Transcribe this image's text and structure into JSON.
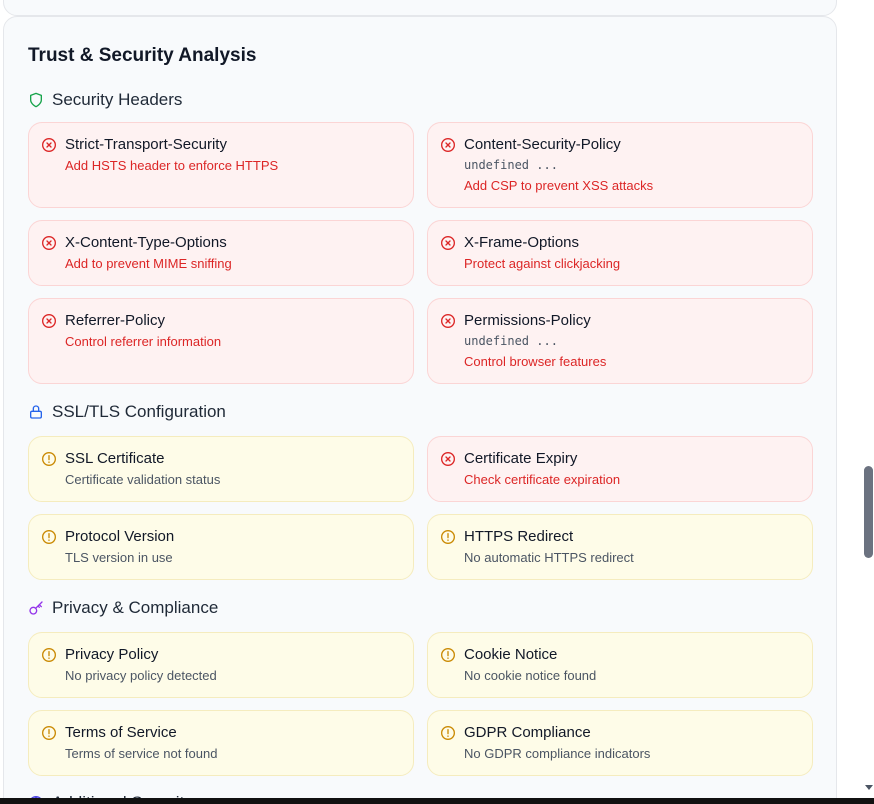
{
  "card_title": "Trust & Security Analysis",
  "sections": {
    "security_headers": {
      "title": "Security Headers",
      "icon": "shield-icon",
      "items": [
        {
          "name": "Strict-Transport-Security",
          "status": "error",
          "desc": "Add HSTS header to enforce HTTPS"
        },
        {
          "name": "Content-Security-Policy",
          "status": "error",
          "value": "undefined ...",
          "desc": "Add CSP to prevent XSS attacks"
        },
        {
          "name": "X-Content-Type-Options",
          "status": "error",
          "desc": "Add to prevent MIME sniffing"
        },
        {
          "name": "X-Frame-Options",
          "status": "error",
          "desc": "Protect against clickjacking"
        },
        {
          "name": "Referrer-Policy",
          "status": "error",
          "desc": "Control referrer information"
        },
        {
          "name": "Permissions-Policy",
          "status": "error",
          "value": "undefined ...",
          "desc": "Control browser features"
        }
      ]
    },
    "ssl_tls": {
      "title": "SSL/TLS Configuration",
      "icon": "lock-icon",
      "items": [
        {
          "name": "SSL Certificate",
          "status": "warning",
          "desc": "Certificate validation status"
        },
        {
          "name": "Certificate Expiry",
          "status": "error",
          "desc": "Check certificate expiration"
        },
        {
          "name": "Protocol Version",
          "status": "warning",
          "desc": "TLS version in use"
        },
        {
          "name": "HTTPS Redirect",
          "status": "warning",
          "desc": "No automatic HTTPS redirect"
        }
      ]
    },
    "privacy": {
      "title": "Privacy & Compliance",
      "icon": "key-icon",
      "items": [
        {
          "name": "Privacy Policy",
          "status": "warning",
          "desc": "No privacy policy detected"
        },
        {
          "name": "Cookie Notice",
          "status": "warning",
          "desc": "No cookie notice found"
        },
        {
          "name": "Terms of Service",
          "status": "warning",
          "desc": "Terms of service not found"
        },
        {
          "name": "GDPR Compliance",
          "status": "warning",
          "desc": "No GDPR compliance indicators"
        }
      ]
    },
    "additional": {
      "title": "Additional Security",
      "icon": "globe-icon"
    }
  },
  "colors": {
    "error": "#dc2626",
    "warning": "#ca8a04",
    "shield": "#16a34a",
    "lock": "#2563eb",
    "key": "#9333ea"
  }
}
